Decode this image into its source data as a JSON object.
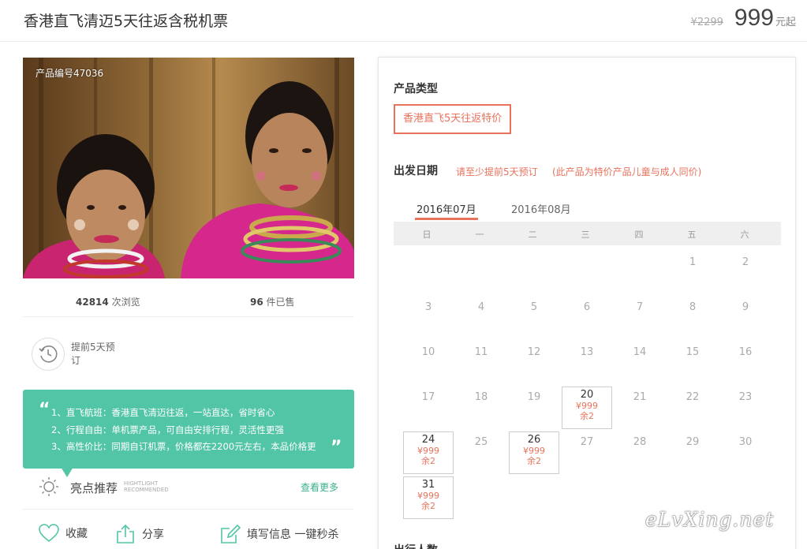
{
  "header": {
    "title": "香港直飞清迈5天往返含税机票",
    "old_price": "¥2299",
    "price": "999",
    "price_suffix": "元起"
  },
  "photo": {
    "product_no": "产品编号47036"
  },
  "stats": {
    "views_value": "42814",
    "views_label": " 次浏览",
    "sold_value": "96",
    "sold_label": " 件已售"
  },
  "advance": {
    "text": "提前5天预订"
  },
  "highlights": {
    "quote_open": "“",
    "quote_close": "”",
    "lines": [
      "1、直飞航班：香港直飞清迈往返，一站直达，省时省心",
      "2、行程自由：单机票产品，可自由安排行程，灵活性更强",
      "3、高性价比：同期自订机票，价格都在2200元左右，本品价格更"
    ]
  },
  "recommend": {
    "title": "亮点推荐",
    "en_line1": "HIGHTLIGHT",
    "en_line2": "RECOMMENDED",
    "more": "查看更多"
  },
  "actions": {
    "favorite": "收藏",
    "share": "分享",
    "book": "填写信息 一键秒杀"
  },
  "panel": {
    "type_label": "产品类型",
    "type_option": "香港直飞5天往返特价",
    "date_label": "出发日期",
    "date_tip1": "请至少提前5天预订",
    "date_tip2": "(此产品为特价产品儿童与成人同价)",
    "people_label": "出行人数"
  },
  "calendar": {
    "months": [
      "2016年07月",
      "2016年08月"
    ],
    "active_month": "2016年07月",
    "weekdays": [
      "日",
      "一",
      "二",
      "三",
      "四",
      "五",
      "六"
    ],
    "days": [
      {
        "d": "1"
      },
      {
        "d": "2"
      },
      {
        "d": "3"
      },
      {
        "d": "4"
      },
      {
        "d": "5"
      },
      {
        "d": "6"
      },
      {
        "d": "7"
      },
      {
        "d": "8"
      },
      {
        "d": "9"
      },
      {
        "d": "10"
      },
      {
        "d": "11"
      },
      {
        "d": "12"
      },
      {
        "d": "13"
      },
      {
        "d": "14"
      },
      {
        "d": "15"
      },
      {
        "d": "16"
      },
      {
        "d": "17"
      },
      {
        "d": "18"
      },
      {
        "d": "19"
      },
      {
        "d": "20",
        "price": "¥999",
        "left": "余2"
      },
      {
        "d": "21"
      },
      {
        "d": "22"
      },
      {
        "d": "23"
      },
      {
        "d": "24",
        "price": "¥999",
        "left": "余2"
      },
      {
        "d": "25"
      },
      {
        "d": "26",
        "price": "¥999",
        "left": "余2"
      },
      {
        "d": "27"
      },
      {
        "d": "28"
      },
      {
        "d": "29"
      },
      {
        "d": "30"
      },
      {
        "d": "31",
        "price": "¥999",
        "left": "余2"
      }
    ],
    "first_weekday": 5
  },
  "watermark": "eLvXing.net",
  "colors": {
    "accent": "#e8735d",
    "teal": "#52c5a6",
    "link_green": "#3bb08d"
  }
}
